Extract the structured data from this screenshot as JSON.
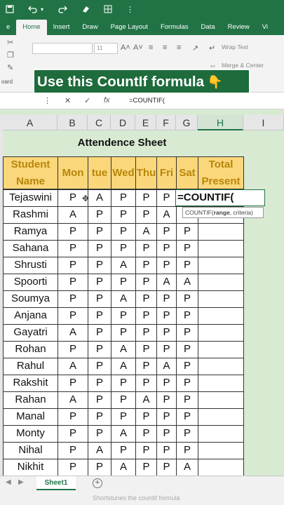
{
  "titlebar": {
    "icons": [
      "save-icon",
      "undo-icon",
      "redo-icon",
      "eraser-icon",
      "grid-icon",
      "more-icon"
    ]
  },
  "ribbon": {
    "tabs": [
      {
        "label": "e",
        "active": false
      },
      {
        "label": "Home",
        "active": true
      },
      {
        "label": "Insert",
        "active": false
      },
      {
        "label": "Draw",
        "active": false
      },
      {
        "label": "Page Layout",
        "active": false
      },
      {
        "label": "Formulas",
        "active": false
      },
      {
        "label": "Data",
        "active": false
      },
      {
        "label": "Review",
        "active": false
      },
      {
        "label": "Vi",
        "active": false
      }
    ],
    "font_size": "11",
    "wrap_text": "Wrap Text",
    "merge_center": "Merge & Center",
    "clipboard_label": "oard"
  },
  "banner": {
    "text": "Use this CountIf formula",
    "icon": "pointing-hand-icon"
  },
  "formula_bar": {
    "formula": "=COUNTIF("
  },
  "grid": {
    "columns": [
      "A",
      "B",
      "C",
      "D",
      "E",
      "F",
      "G",
      "H",
      "I"
    ],
    "selected_column": "H",
    "sheet_title": "Attendence Sheet",
    "headers": {
      "name": "Student Name",
      "days": [
        "Mon",
        "tue",
        "Wed",
        "Thu",
        "Fri",
        "Sat"
      ],
      "total": "Total Present"
    },
    "rows": [
      {
        "name": "Tejaswini",
        "days": [
          "P",
          "A",
          "P",
          "P",
          "P",
          ""
        ]
      },
      {
        "name": "Rashmi",
        "days": [
          "A",
          "P",
          "P",
          "P",
          "A",
          ""
        ]
      },
      {
        "name": "Ramya",
        "days": [
          "P",
          "P",
          "P",
          "A",
          "P",
          "P"
        ]
      },
      {
        "name": "Sahana",
        "days": [
          "P",
          "P",
          "P",
          "P",
          "P",
          "P"
        ]
      },
      {
        "name": "Shrusti",
        "days": [
          "P",
          "P",
          "A",
          "P",
          "P",
          "P"
        ]
      },
      {
        "name": "Spoorti",
        "days": [
          "P",
          "P",
          "P",
          "P",
          "A",
          "A"
        ]
      },
      {
        "name": "Soumya",
        "days": [
          "P",
          "P",
          "A",
          "P",
          "P",
          "P"
        ]
      },
      {
        "name": "Anjana",
        "days": [
          "P",
          "P",
          "P",
          "P",
          "P",
          "P"
        ]
      },
      {
        "name": "Gayatri",
        "days": [
          "A",
          "P",
          "P",
          "P",
          "P",
          "P"
        ]
      },
      {
        "name": "Rohan",
        "days": [
          "P",
          "P",
          "A",
          "P",
          "P",
          "P"
        ]
      },
      {
        "name": "Rahul",
        "days": [
          "A",
          "P",
          "A",
          "P",
          "A",
          "P"
        ]
      },
      {
        "name": "Rakshit",
        "days": [
          "P",
          "P",
          "P",
          "P",
          "P",
          "P"
        ]
      },
      {
        "name": "Rahan",
        "days": [
          "A",
          "P",
          "P",
          "A",
          "P",
          "P"
        ]
      },
      {
        "name": "Manal",
        "days": [
          "P",
          "P",
          "P",
          "P",
          "P",
          "P"
        ]
      },
      {
        "name": "Monty",
        "days": [
          "P",
          "P",
          "A",
          "P",
          "P",
          "P"
        ]
      },
      {
        "name": "Nihal",
        "days": [
          "P",
          "A",
          "P",
          "P",
          "P",
          "P"
        ]
      },
      {
        "name": "Nikhit",
        "days": [
          "P",
          "P",
          "A",
          "P",
          "P",
          "A"
        ]
      }
    ],
    "active_cell_text": "=COUNTIF(",
    "tooltip": "COUNTIF(range, criteria)"
  },
  "sheets": {
    "active": "Sheet1",
    "caption": "Shortstunes the countif formula"
  },
  "colors": {
    "excel_green": "#217346",
    "header_fill": "#fad77a",
    "header_text": "#b8860b",
    "sheet_bg": "#d9ead3"
  }
}
